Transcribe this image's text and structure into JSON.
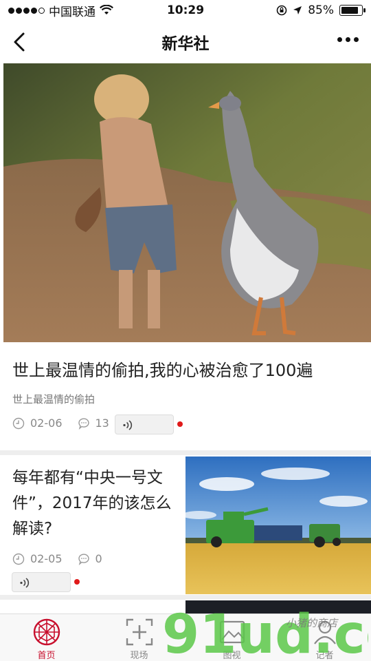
{
  "status_bar": {
    "carrier": "中国联通",
    "time": "10:29",
    "battery": "85%",
    "battery_level": 0.85
  },
  "nav": {
    "title": "新华社"
  },
  "feed": [
    {
      "title": "世上最温情的偷拍,我的心被治愈了100遍",
      "subtitle": "世上最温情的偷拍",
      "date": "02-06",
      "comments": "13"
    },
    {
      "title": "每年都有“中央一号文件”，2017年的该怎么解读?",
      "date": "02-05",
      "comments": "0"
    }
  ],
  "tabs": [
    {
      "label": "首页",
      "icon": "home-logo-icon",
      "active": true
    },
    {
      "label": "现场",
      "icon": "live-scene-icon"
    },
    {
      "label": "图视",
      "icon": "picture-icon"
    },
    {
      "label": "记者",
      "icon": "reporter-icon"
    }
  ],
  "watermark": {
    "text": "91ud.com",
    "script": "小猪的商店"
  },
  "colors": {
    "accent": "#c8102e",
    "red_dot": "#e01a1a",
    "watermark_green": "#5cc84a"
  }
}
